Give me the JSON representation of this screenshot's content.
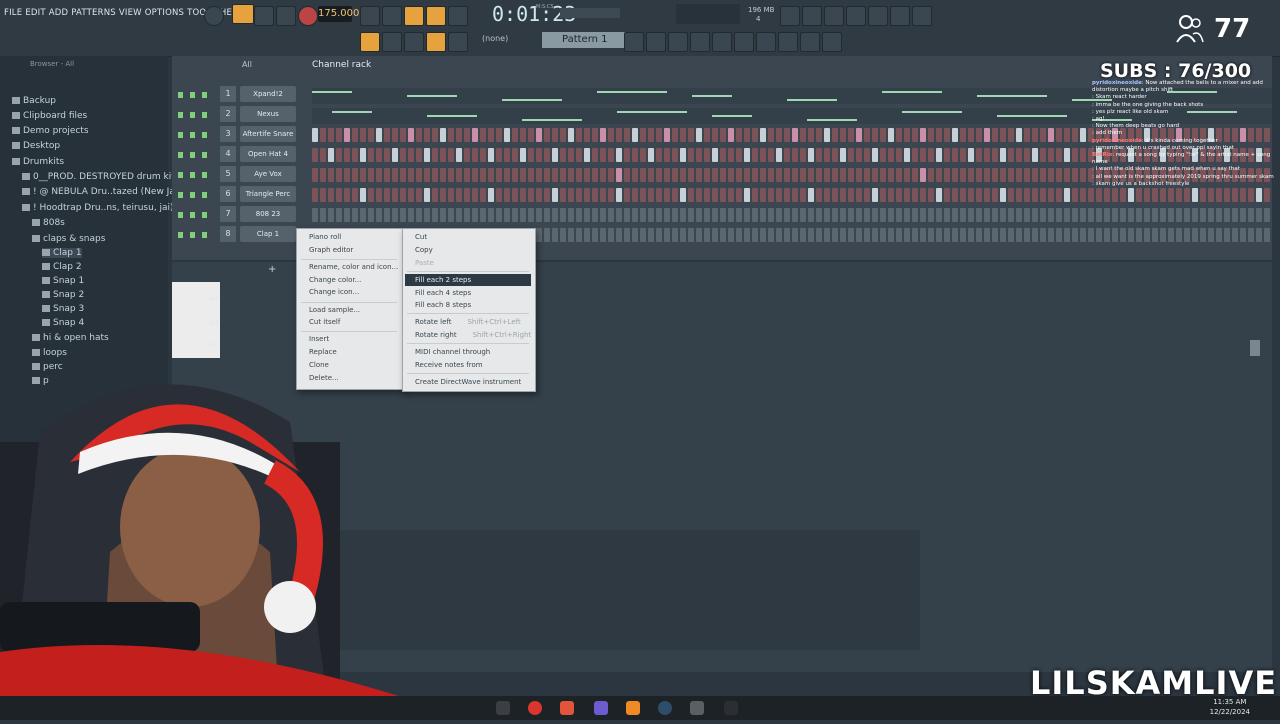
{
  "menubar": {
    "items": [
      "FILE",
      "EDIT",
      "ADD",
      "PATTERNS",
      "VIEW",
      "OPTIONS",
      "TOOLS",
      "HELP"
    ],
    "tempo": "175.000",
    "time": "0:01:23",
    "time_unit": "M:S:CS",
    "memory": "196 MB",
    "memory_sub": "4",
    "pattern": "Pattern 1",
    "none_label": "(none)"
  },
  "browser": {
    "title": "Browser - All",
    "items": [
      {
        "label": "Backup",
        "indent": 0
      },
      {
        "label": "Clipboard files",
        "indent": 0
      },
      {
        "label": "Demo projects",
        "indent": 0
      },
      {
        "label": "Desktop",
        "indent": 0
      },
      {
        "label": "Drumkits",
        "indent": 0
      },
      {
        "label": "0__PROD. DESTROYED drum kit 2",
        "indent": 1
      },
      {
        "label": "! @ NEBULA Dru..tazed (New Jazz)",
        "indent": 1
      },
      {
        "label": "! Hoodtrap Dru..ns, teirusu, jai)",
        "indent": 1
      },
      {
        "label": "808s",
        "indent": 2
      },
      {
        "label": "claps & snaps",
        "indent": 2
      },
      {
        "label": "Clap 1",
        "indent": 3
      },
      {
        "label": "Clap 2",
        "indent": 3
      },
      {
        "label": "Snap 1",
        "indent": 3
      },
      {
        "label": "Snap 2",
        "indent": 3
      },
      {
        "label": "Snap 3",
        "indent": 3
      },
      {
        "label": "Snap 4",
        "indent": 3
      },
      {
        "label": "hi & open hats",
        "indent": 2
      },
      {
        "label": "loops",
        "indent": 2
      },
      {
        "label": "perc",
        "indent": 2
      },
      {
        "label": "p",
        "indent": 2
      }
    ]
  },
  "rack": {
    "title": "Channel rack",
    "filter": "All",
    "channels": [
      {
        "num": "1",
        "name": "Xpand!2",
        "type": "pr"
      },
      {
        "num": "2",
        "name": "Nexus",
        "type": "pr"
      },
      {
        "num": "3",
        "name": "Aftertife Snare",
        "type": "steps"
      },
      {
        "num": "4",
        "name": "Open Hat 4",
        "type": "steps"
      },
      {
        "num": "5",
        "name": "Aye Vox",
        "type": "steps"
      },
      {
        "num": "6",
        "name": "Triangle Perc",
        "type": "steps"
      },
      {
        "num": "7",
        "name": "808 23",
        "type": "steps"
      },
      {
        "num": "8",
        "name": "Clap 1",
        "type": "steps"
      }
    ]
  },
  "context_menu_left": {
    "items": [
      {
        "label": "Piano roll"
      },
      {
        "label": "Graph editor"
      },
      {
        "label": "Rename, color and icon..."
      },
      {
        "label": "Change color..."
      },
      {
        "label": "Change icon..."
      },
      {
        "label": "Load sample..."
      },
      {
        "label": "Cut itself"
      },
      {
        "label": "Insert"
      },
      {
        "label": "Replace"
      },
      {
        "label": "Clone"
      },
      {
        "label": "Delete..."
      }
    ]
  },
  "context_menu_right": {
    "items": [
      {
        "label": "Cut",
        "shortcut": ""
      },
      {
        "label": "Copy",
        "shortcut": ""
      },
      {
        "label": "Paste",
        "shortcut": ""
      },
      {
        "label": "Fill each 2 steps",
        "shortcut": ""
      },
      {
        "label": "Fill each 4 steps",
        "shortcut": ""
      },
      {
        "label": "Fill each 8 steps",
        "shortcut": ""
      },
      {
        "label": "Rotate left",
        "shortcut": "Shift+Ctrl+Left"
      },
      {
        "label": "Rotate right",
        "shortcut": "Shift+Ctrl+Right"
      },
      {
        "label": "MIDI channel through",
        "shortcut": ""
      },
      {
        "label": "Receive notes from",
        "shortcut": ""
      },
      {
        "label": "Create DirectWave instrument",
        "shortcut": ""
      }
    ]
  },
  "piano_keys": [
    "A4",
    "G4",
    "F4"
  ],
  "chat": [
    {
      "user": "pyridoxineoxide",
      "msg": ": Now attached the bells to a mixer and add distortion maybe a pitch shift"
    },
    {
      "user": "",
      "msg": ": Skam react harder"
    },
    {
      "user": "",
      "msg": ": imma be the one giving the back shots"
    },
    {
      "user": "",
      "msg": ": yes plz react like old skam"
    },
    {
      "user": "",
      "msg": ": ag!"
    },
    {
      "user": "",
      "msg": ": Now them deep beats go hard"
    },
    {
      "user": "",
      "msg": ": add them"
    },
    {
      "user": "pyridoxineoxide",
      "msg": ": it's kinda coming together"
    },
    {
      "user": "",
      "msg": ": remember when u crashed out over ppl sayin that"
    },
    {
      "user": "",
      "msg": ""
    },
    {
      "user": "BotRix",
      "msg": ": request a song by typing \"!sr\" & the artist name + song name"
    },
    {
      "user": "",
      "msg": ": I want the old skam skam gets mad when u say that"
    },
    {
      "user": "",
      "msg": ": all we want is the approximately 2019 spring thru summer skam"
    },
    {
      "user": "",
      "msg": ": skam give us a backshot freestyle"
    }
  ],
  "overlay": {
    "viewers": "77",
    "subs": "SUBS : 76/300",
    "brand": "LILSKAMLIVE"
  },
  "taskbar": {
    "time": "11:35 AM",
    "date": "12/22/2024"
  },
  "colors": {
    "accent": "#e6a23c",
    "rack_bg": "#3b4650",
    "step_on": "#c7d0d6",
    "step_off": "#7c5358"
  }
}
